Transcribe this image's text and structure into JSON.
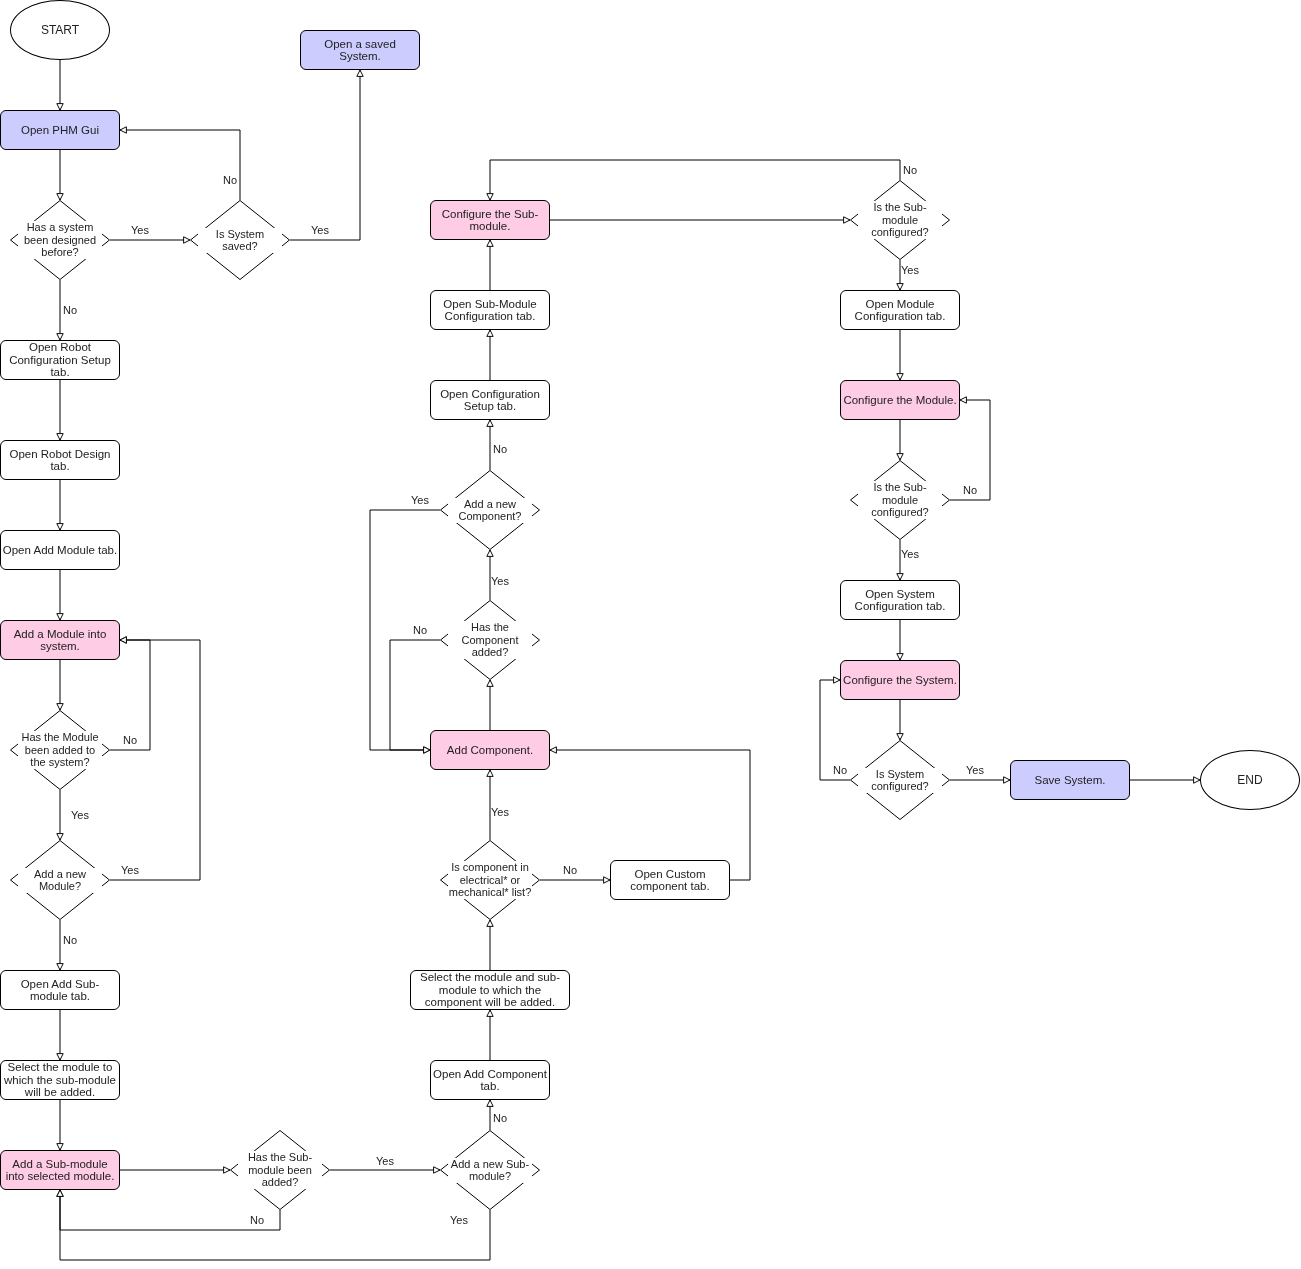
{
  "nodes": [
    {
      "kind": "terminal",
      "text": "START"
    },
    {
      "kind": "process",
      "text": "Open a saved System.",
      "color": "#ccccff"
    },
    {
      "kind": "process",
      "text": "Open PHM Gui",
      "color": "#ccccff"
    },
    {
      "kind": "process",
      "text": "Configure the Sub-module.",
      "color": "#ffcce6"
    },
    {
      "kind": "decision",
      "text": "Is the Sub-module configured?"
    },
    {
      "kind": "decision",
      "text": "Has a system been designed before?"
    },
    {
      "kind": "decision",
      "text": "Is System saved?"
    },
    {
      "kind": "process",
      "text": "Open Sub-Module Configuration tab.",
      "color": "#ffffff"
    },
    {
      "kind": "process",
      "text": "Open Module Configuration tab.",
      "color": "#ffffff"
    },
    {
      "kind": "process",
      "text": "Open Robot Configuration Setup tab.",
      "color": "#ffffff"
    },
    {
      "kind": "process",
      "text": "Open Configuration Setup tab.",
      "color": "#ffffff"
    },
    {
      "kind": "process",
      "text": "Configure the Module.",
      "color": "#ffcce6"
    },
    {
      "kind": "process",
      "text": "Open Robot Design tab.",
      "color": "#ffffff"
    },
    {
      "kind": "decision",
      "text": "Add a new Component?"
    },
    {
      "kind": "decision",
      "text": "Is the Sub-module configured?"
    },
    {
      "kind": "process",
      "text": "Open Add Module tab.",
      "color": "#ffffff"
    },
    {
      "kind": "process",
      "text": "Open System Configuration tab.",
      "color": "#ffffff"
    },
    {
      "kind": "process",
      "text": "Add a Module into system.",
      "color": "#ffcce6"
    },
    {
      "kind": "decision",
      "text": "Has the Component added?"
    },
    {
      "kind": "process",
      "text": "Configure the System.",
      "color": "#ffcce6"
    },
    {
      "kind": "decision",
      "text": "Has the Module been added to the system?"
    },
    {
      "kind": "process",
      "text": "Add Component.",
      "color": "#ffcce6"
    },
    {
      "kind": "decision",
      "text": "Is System configured?"
    },
    {
      "kind": "process",
      "text": "Save System.",
      "color": "#ccccff"
    },
    {
      "kind": "terminal",
      "text": "END"
    },
    {
      "kind": "decision",
      "text": "Add a new Module?"
    },
    {
      "kind": "decision",
      "text": "Is component in electrical* or mechanical* list?"
    },
    {
      "kind": "process",
      "text": "Open Custom component tab.",
      "color": "#ffffff"
    },
    {
      "kind": "process",
      "text": "Open Add Sub-module tab.",
      "color": "#ffffff"
    },
    {
      "kind": "process",
      "text": "Select the module and sub-module to which the component will be added.",
      "color": "#ffffff"
    },
    {
      "kind": "process",
      "text": "Select the module to which the sub-module will be added.",
      "color": "#ffffff"
    },
    {
      "kind": "process",
      "text": "Open Add Component tab.",
      "color": "#ffffff"
    },
    {
      "kind": "process",
      "text": "Add a Sub-module into selected module.",
      "color": "#ffcce6"
    },
    {
      "kind": "decision",
      "text": "Has the Sub-module been added?"
    },
    {
      "kind": "decision",
      "text": "Add a new Sub-module?"
    }
  ],
  "edges": [
    {
      "label": "No"
    },
    {
      "label": "No"
    },
    {
      "label": "Yes"
    },
    {
      "label": "Yes"
    },
    {
      "label": "Yes"
    },
    {
      "label": "No"
    },
    {
      "label": "No"
    },
    {
      "label": "No"
    },
    {
      "label": "Yes"
    },
    {
      "label": "Yes"
    },
    {
      "label": "Yes"
    },
    {
      "label": "No"
    },
    {
      "label": "No"
    },
    {
      "label": "No"
    },
    {
      "label": "Yes"
    },
    {
      "label": "Yes"
    },
    {
      "label": "Yes"
    },
    {
      "label": "Yes"
    },
    {
      "label": "No"
    },
    {
      "label": "No"
    },
    {
      "label": "No"
    },
    {
      "label": "Yes"
    },
    {
      "label": "No"
    },
    {
      "label": "Yes"
    }
  ]
}
